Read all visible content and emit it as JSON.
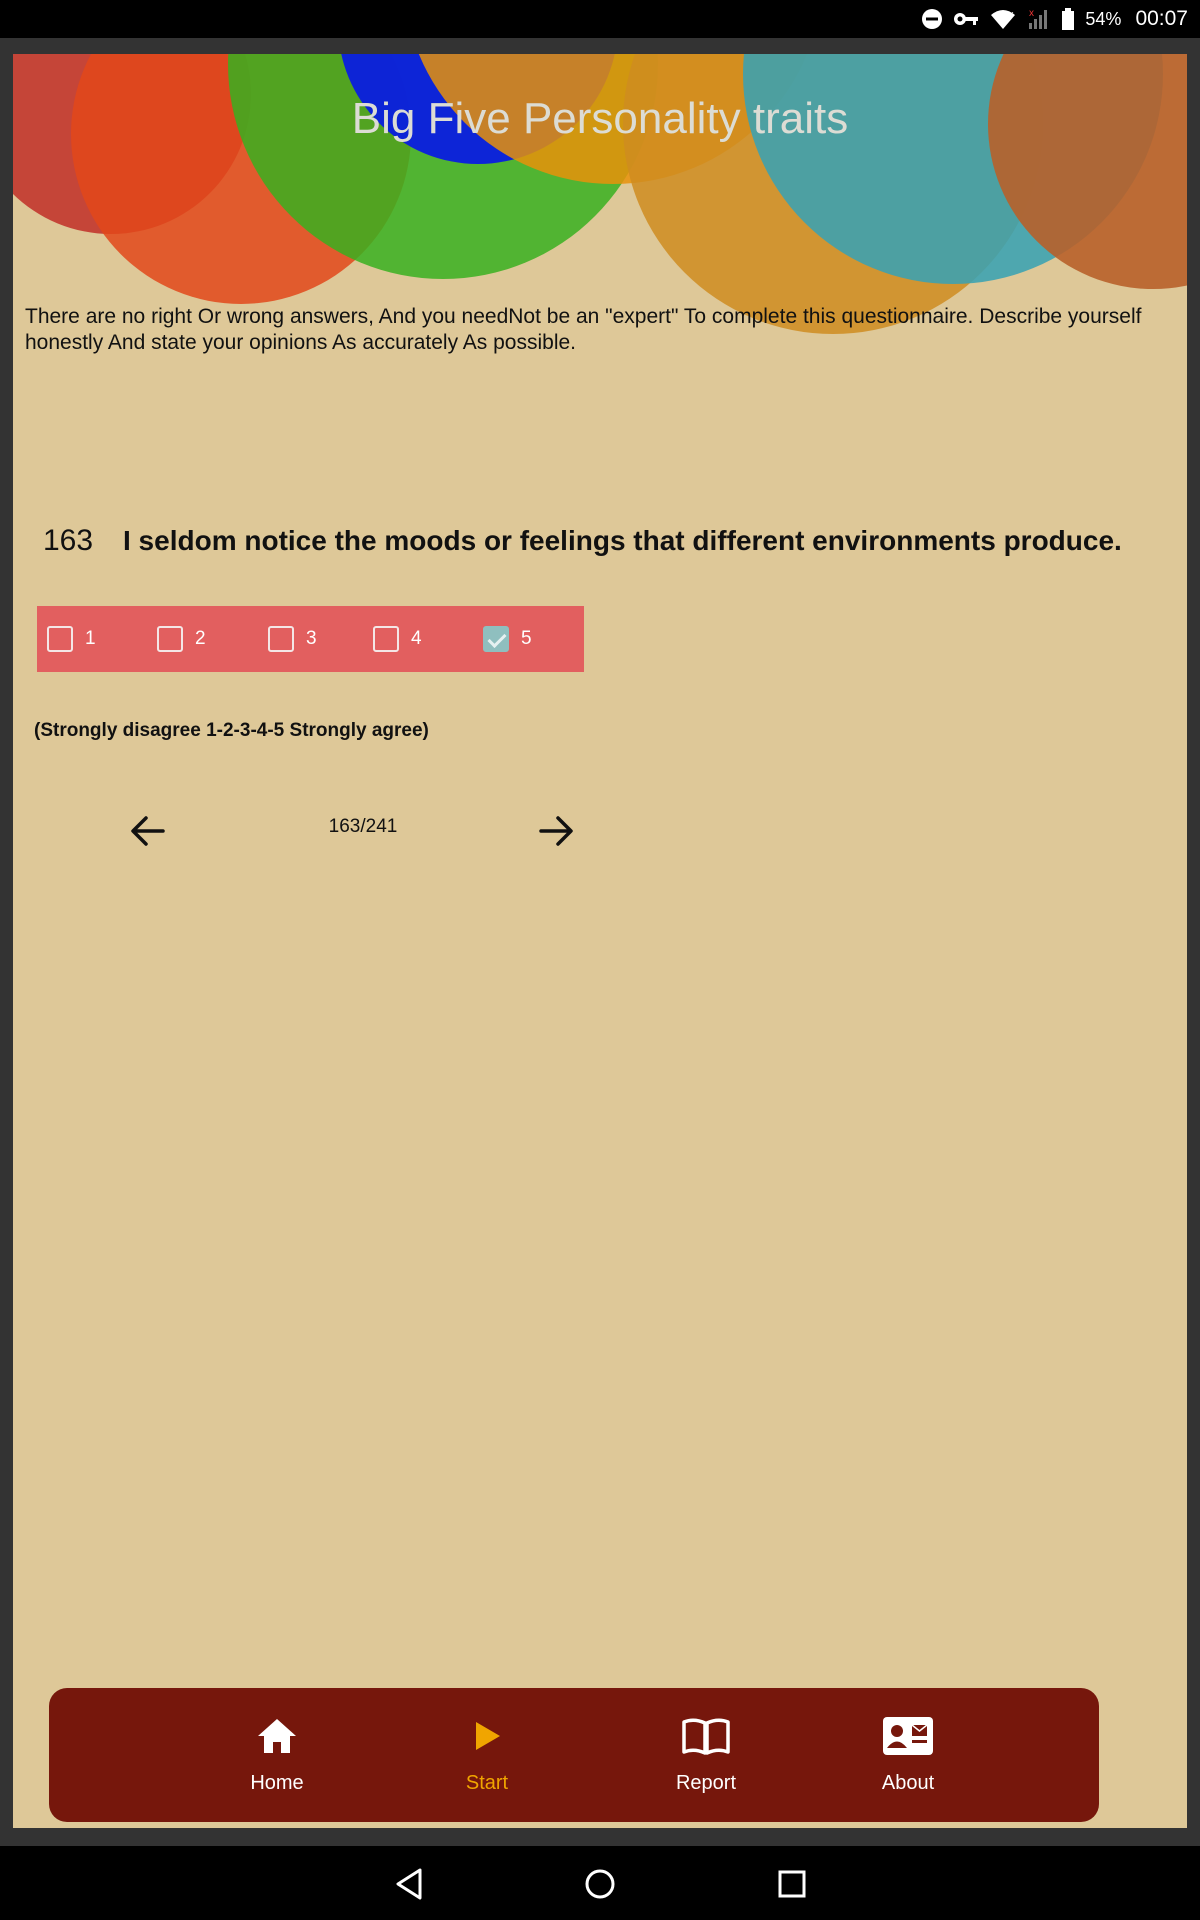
{
  "status_bar": {
    "battery_text": "54%",
    "time": "00:07",
    "icons": [
      "do-not-disturb-icon",
      "vpn-key-icon",
      "wifi-icon",
      "signal-icon",
      "battery-icon"
    ]
  },
  "app": {
    "title": "Big Five Personality traits",
    "intro": "There are no right Or wrong answers, And you needNot be an \"expert\" To complete this questionnaire. Describe yourself honestly And state your opinions As accurately As possible.",
    "question": {
      "number": "163",
      "text": "I seldom notice the moods or feelings that different environments produce."
    },
    "options": [
      {
        "label": "1",
        "checked": false
      },
      {
        "label": "2",
        "checked": false
      },
      {
        "label": "3",
        "checked": false
      },
      {
        "label": "4",
        "checked": false
      },
      {
        "label": "5",
        "checked": true
      }
    ],
    "scale_note": "(Strongly disagree 1-2-3-4-5 Strongly agree)",
    "progress": "163/241",
    "colors": {
      "background": "#dec898",
      "answer_bar": "#e25f5f",
      "bottom_nav": "#76170c",
      "active_accent": "#f0a500"
    }
  },
  "bottom_nav": {
    "items": [
      {
        "label": "Home",
        "icon": "home-icon",
        "active": false
      },
      {
        "label": "Start",
        "icon": "play-icon",
        "active": true
      },
      {
        "label": "Report",
        "icon": "book-icon",
        "active": false
      },
      {
        "label": "About",
        "icon": "contact-card-icon",
        "active": false
      }
    ]
  },
  "system_nav": {
    "icons": [
      "back-icon",
      "home-circle-icon",
      "recents-icon"
    ]
  }
}
